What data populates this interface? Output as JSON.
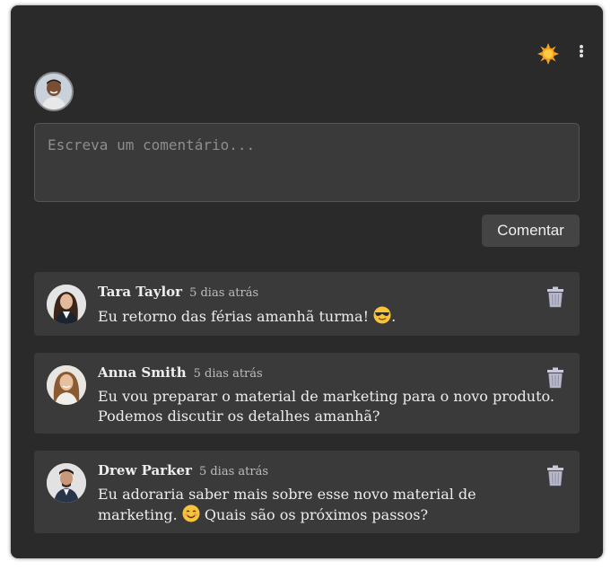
{
  "composer": {
    "placeholder": "Escreva um comentário...",
    "submit_label": "Comentar"
  },
  "comments": [
    {
      "author": "Tara Taylor",
      "time": "5 dias atrás",
      "text_before": "Eu retorno das férias amanhã turma!",
      "emoji": "smiling-face-with-sunglasses-emoji",
      "text_after": "."
    },
    {
      "author": "Anna Smith",
      "time": "5 dias atrás",
      "text": "Eu vou preparar o material de marketing para o novo produto. Podemos discutir os detalhes amanhã?"
    },
    {
      "author": "Drew Parker",
      "time": "5 dias atrás",
      "text_before": "Eu adoraria saber mais sobre esse novo material de marketing.",
      "emoji": "smiling-face-emoji",
      "text_after": "Quais são os próximos passos?"
    }
  ],
  "colors": {
    "panel_bg": "#2a2a2a",
    "card_bg": "#3a3a3a",
    "button_bg": "#444444",
    "sun_icon": "#f5a623"
  }
}
